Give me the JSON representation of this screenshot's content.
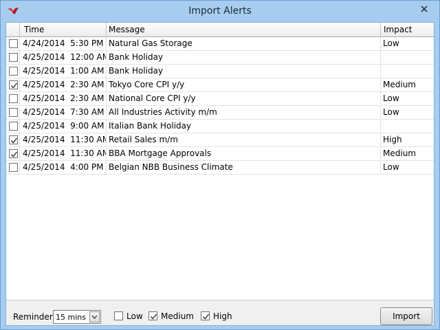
{
  "window": {
    "title": "Import Alerts",
    "accent_color": "#a6cdef",
    "app_icon": "red-bird-logo-icon",
    "close_icon": "close-icon"
  },
  "grid": {
    "columns": {
      "time": "Time",
      "message": "Message",
      "impact": "Impact"
    },
    "rows": [
      {
        "checked": false,
        "time": "4/24/2014  5:30 PM",
        "message": "Natural Gas Storage",
        "impact": "Low"
      },
      {
        "checked": false,
        "time": "4/25/2014  12:00 AM",
        "message": "Bank Holiday",
        "impact": ""
      },
      {
        "checked": false,
        "time": "4/25/2014  1:00 AM",
        "message": "Bank Holiday",
        "impact": ""
      },
      {
        "checked": true,
        "time": "4/25/2014  2:30 AM",
        "message": "Tokyo Core CPI y/y",
        "impact": "Medium"
      },
      {
        "checked": false,
        "time": "4/25/2014  2:30 AM",
        "message": "National Core CPI y/y",
        "impact": "Low"
      },
      {
        "checked": false,
        "time": "4/25/2014  7:30 AM",
        "message": "All Industries Activity m/m",
        "impact": "Low"
      },
      {
        "checked": false,
        "time": "4/25/2014  9:00 AM",
        "message": "Italian Bank Holiday",
        "impact": ""
      },
      {
        "checked": true,
        "time": "4/25/2014  11:30 AM",
        "message": "Retail Sales m/m",
        "impact": "High"
      },
      {
        "checked": true,
        "time": "4/25/2014  11:30 AM",
        "message": "BBA Mortgage Approvals",
        "impact": "Medium"
      },
      {
        "checked": false,
        "time": "4/25/2014  4:00 PM",
        "message": "Belgian NBB Business Climate",
        "impact": "Low"
      }
    ]
  },
  "footer": {
    "reminder_label": "Reminder",
    "reminder_value": "15 mins",
    "filters": [
      {
        "label": "Low",
        "checked": false
      },
      {
        "label": "Medium",
        "checked": true
      },
      {
        "label": "High",
        "checked": true
      }
    ],
    "import_label": "Import"
  }
}
